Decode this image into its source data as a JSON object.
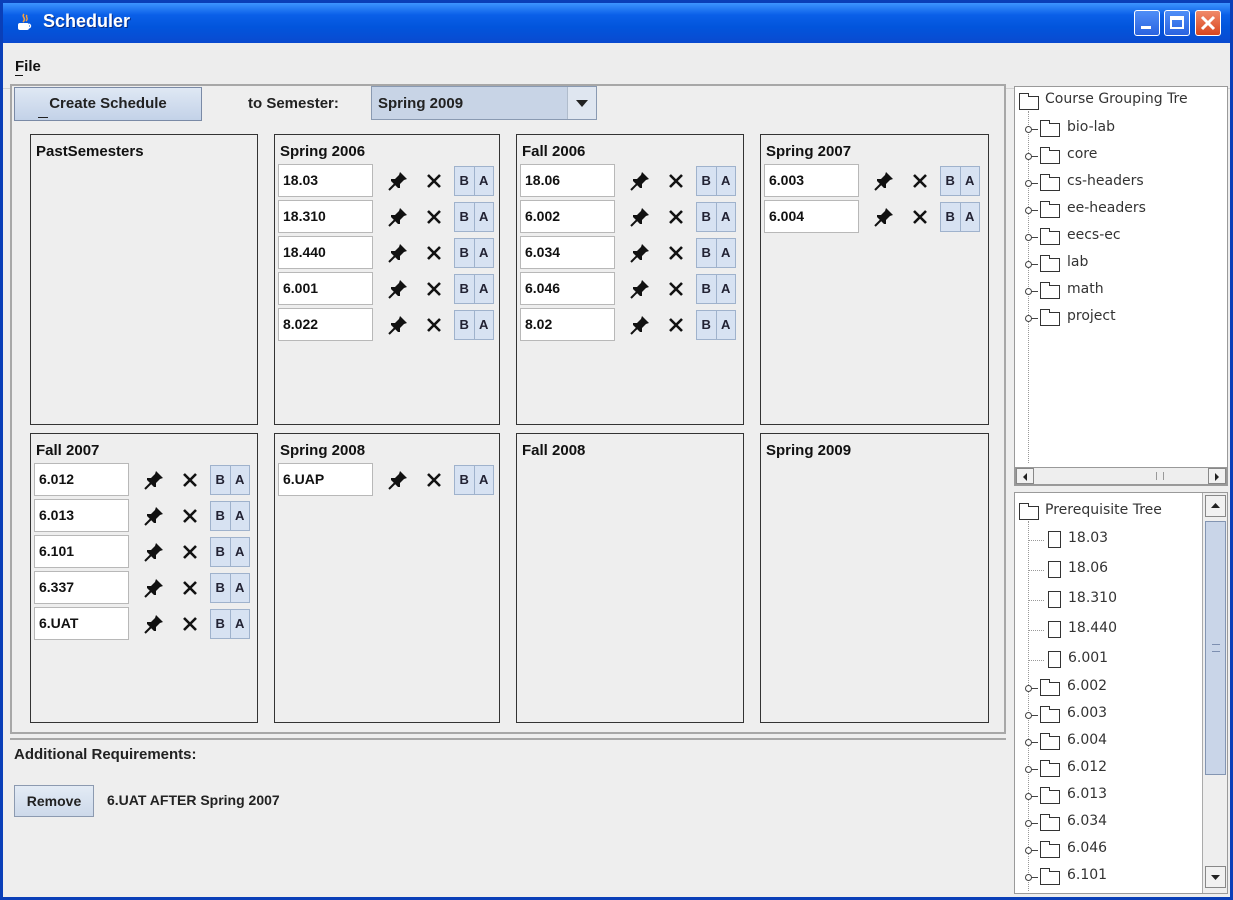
{
  "window": {
    "title": "Scheduler",
    "minimize": "_",
    "maximize": "□",
    "close": "✕"
  },
  "menu": {
    "file": "File"
  },
  "toolbar": {
    "create_label": "Create Schedule",
    "semester_label": "to Semester:",
    "semester_value": "Spring 2009"
  },
  "button_labels": {
    "before": "B",
    "after": "A"
  },
  "semesters": [
    {
      "title": "PastSemesters",
      "courses": []
    },
    {
      "title": "Spring 2006",
      "courses": [
        "18.03",
        "18.310",
        "18.440",
        "6.001",
        "8.022"
      ]
    },
    {
      "title": "Fall 2006",
      "courses": [
        "18.06",
        "6.002",
        "6.034",
        "6.046",
        "8.02"
      ]
    },
    {
      "title": "Spring 2007",
      "courses": [
        "6.003",
        "6.004"
      ]
    },
    {
      "title": "Fall 2007",
      "courses": [
        "6.012",
        "6.013",
        "6.101",
        "6.337",
        "6.UAT"
      ]
    },
    {
      "title": "Spring 2008",
      "courses": [
        "6.UAP"
      ]
    },
    {
      "title": "Fall 2008",
      "courses": []
    },
    {
      "title": "Spring 2009",
      "courses": []
    }
  ],
  "additional": {
    "title": "Additional Requirements:",
    "remove_label": "Remove",
    "requirement": "6.UAT AFTER Spring 2007"
  },
  "course_tree": {
    "root": "Course Grouping Tre",
    "items": [
      "bio-lab",
      "core",
      "cs-headers",
      "ee-headers",
      "eecs-ec",
      "lab",
      "math",
      "project"
    ]
  },
  "prereq_tree": {
    "root": "Prerequisite Tree",
    "leaves": [
      "18.03",
      "18.06",
      "18.310",
      "18.440",
      "6.001"
    ],
    "folders": [
      "6.002",
      "6.003",
      "6.004",
      "6.012",
      "6.013",
      "6.034",
      "6.046",
      "6.101"
    ]
  },
  "colors": {
    "title_bar": "#0a5fe8",
    "accent": "#c8d4e6",
    "panel_bg": "#eeeeee"
  }
}
